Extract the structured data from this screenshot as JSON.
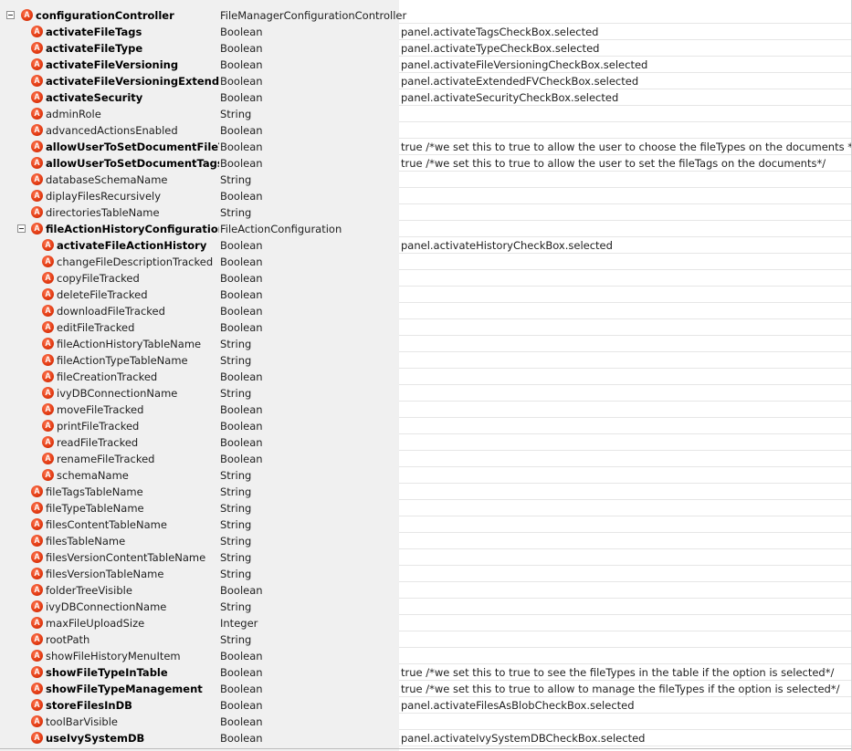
{
  "icon_letter": "A",
  "colors": {
    "icon_red": "#e23a12",
    "left_bg": "#f0f0f0",
    "right_bg": "#ffffff"
  },
  "rows": [
    {
      "level": 0,
      "expanded": true,
      "bold": true,
      "name": "configurationController",
      "type": "FileManagerConfigurationController",
      "value": ""
    },
    {
      "level": 1,
      "bold": true,
      "name": "activateFileTags",
      "type": "Boolean",
      "value": "panel.activateTagsCheckBox.selected"
    },
    {
      "level": 1,
      "bold": true,
      "name": "activateFileType",
      "type": "Boolean",
      "value": "panel.activateTypeCheckBox.selected"
    },
    {
      "level": 1,
      "bold": true,
      "name": "activateFileVersioning",
      "type": "Boolean",
      "value": "panel.activateFileVersioningCheckBox.selected"
    },
    {
      "level": 1,
      "bold": true,
      "name": "activateFileVersioningExtended",
      "type": "Boolean",
      "value": "panel.activateExtendedFVCheckBox.selected"
    },
    {
      "level": 1,
      "bold": true,
      "name": "activateSecurity",
      "type": "Boolean",
      "value": "panel.activateSecurityCheckBox.selected"
    },
    {
      "level": 1,
      "bold": false,
      "name": "adminRole",
      "type": "String",
      "value": ""
    },
    {
      "level": 1,
      "bold": false,
      "name": "advancedActionsEnabled",
      "type": "Boolean",
      "value": ""
    },
    {
      "level": 1,
      "bold": true,
      "name": "allowUserToSetDocumentFileType",
      "type": "Boolean",
      "value": "true /*we set this to true to allow the user to choose the fileTypes on the documents */"
    },
    {
      "level": 1,
      "bold": true,
      "name": "allowUserToSetDocumentTags",
      "type": "Boolean",
      "value": "true /*we set this to true to allow the user to set the fileTags on the documents*/"
    },
    {
      "level": 1,
      "bold": false,
      "name": "databaseSchemaName",
      "type": "String",
      "value": ""
    },
    {
      "level": 1,
      "bold": false,
      "name": "diplayFilesRecursively",
      "type": "Boolean",
      "value": ""
    },
    {
      "level": 1,
      "bold": false,
      "name": "directoriesTableName",
      "type": "String",
      "value": ""
    },
    {
      "level": 1,
      "expanded": true,
      "bold": true,
      "name": "fileActionHistoryConfiguration",
      "type": "FileActionConfiguration",
      "value": ""
    },
    {
      "level": 2,
      "bold": true,
      "name": "activateFileActionHistory",
      "type": "Boolean",
      "value": "panel.activateHistoryCheckBox.selected"
    },
    {
      "level": 2,
      "bold": false,
      "name": "changeFileDescriptionTracked",
      "type": "Boolean",
      "value": ""
    },
    {
      "level": 2,
      "bold": false,
      "name": "copyFileTracked",
      "type": "Boolean",
      "value": ""
    },
    {
      "level": 2,
      "bold": false,
      "name": "deleteFileTracked",
      "type": "Boolean",
      "value": ""
    },
    {
      "level": 2,
      "bold": false,
      "name": "downloadFileTracked",
      "type": "Boolean",
      "value": ""
    },
    {
      "level": 2,
      "bold": false,
      "name": "editFileTracked",
      "type": "Boolean",
      "value": ""
    },
    {
      "level": 2,
      "bold": false,
      "name": "fileActionHistoryTableName",
      "type": "String",
      "value": ""
    },
    {
      "level": 2,
      "bold": false,
      "name": "fileActionTypeTableName",
      "type": "String",
      "value": ""
    },
    {
      "level": 2,
      "bold": false,
      "name": "fileCreationTracked",
      "type": "Boolean",
      "value": ""
    },
    {
      "level": 2,
      "bold": false,
      "name": "ivyDBConnectionName",
      "type": "String",
      "value": ""
    },
    {
      "level": 2,
      "bold": false,
      "name": "moveFileTracked",
      "type": "Boolean",
      "value": ""
    },
    {
      "level": 2,
      "bold": false,
      "name": "printFileTracked",
      "type": "Boolean",
      "value": ""
    },
    {
      "level": 2,
      "bold": false,
      "name": "readFileTracked",
      "type": "Boolean",
      "value": ""
    },
    {
      "level": 2,
      "bold": false,
      "name": "renameFileTracked",
      "type": "Boolean",
      "value": ""
    },
    {
      "level": 2,
      "bold": false,
      "name": "schemaName",
      "type": "String",
      "value": ""
    },
    {
      "level": 1,
      "bold": false,
      "name": "fileTagsTableName",
      "type": "String",
      "value": ""
    },
    {
      "level": 1,
      "bold": false,
      "name": "fileTypeTableName",
      "type": "String",
      "value": ""
    },
    {
      "level": 1,
      "bold": false,
      "name": "filesContentTableName",
      "type": "String",
      "value": ""
    },
    {
      "level": 1,
      "bold": false,
      "name": "filesTableName",
      "type": "String",
      "value": ""
    },
    {
      "level": 1,
      "bold": false,
      "name": "filesVersionContentTableName",
      "type": "String",
      "value": ""
    },
    {
      "level": 1,
      "bold": false,
      "name": "filesVersionTableName",
      "type": "String",
      "value": ""
    },
    {
      "level": 1,
      "bold": false,
      "name": "folderTreeVisible",
      "type": "Boolean",
      "value": ""
    },
    {
      "level": 1,
      "bold": false,
      "name": "ivyDBConnectionName",
      "type": "String",
      "value": ""
    },
    {
      "level": 1,
      "bold": false,
      "name": "maxFileUploadSize",
      "type": "Integer",
      "value": ""
    },
    {
      "level": 1,
      "bold": false,
      "name": "rootPath",
      "type": "String",
      "value": ""
    },
    {
      "level": 1,
      "bold": false,
      "name": "showFileHistoryMenuItem",
      "type": "Boolean",
      "value": ""
    },
    {
      "level": 1,
      "bold": true,
      "name": "showFileTypeInTable",
      "type": "Boolean",
      "value": "true /*we set this to true to see the fileTypes in the table if the option is selected*/"
    },
    {
      "level": 1,
      "bold": true,
      "name": "showFileTypeManagement",
      "type": "Boolean",
      "value": "true /*we set this to true to allow to manage the fileTypes if the option is selected*/"
    },
    {
      "level": 1,
      "bold": true,
      "name": "storeFilesInDB",
      "type": "Boolean",
      "value": "panel.activateFilesAsBlobCheckBox.selected"
    },
    {
      "level": 1,
      "bold": false,
      "name": "toolBarVisible",
      "type": "Boolean",
      "value": ""
    },
    {
      "level": 1,
      "bold": true,
      "name": "useIvySystemDB",
      "type": "Boolean",
      "value": "panel.activateIvySystemDBCheckBox.selected"
    }
  ]
}
